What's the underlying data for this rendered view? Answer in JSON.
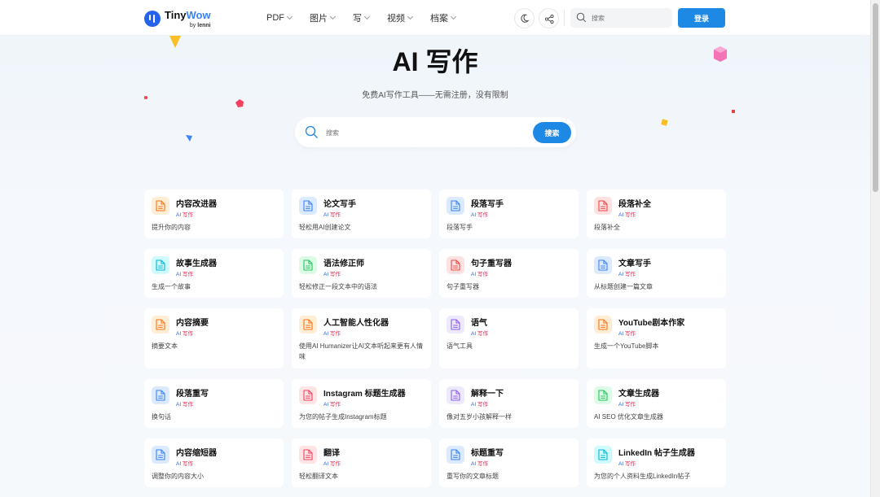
{
  "header": {
    "logo_tiny": "Tiny",
    "logo_wow": "Wow",
    "logo_by": "by",
    "logo_lenni": "lenni",
    "nav": [
      {
        "label": "PDF"
      },
      {
        "label": "图片"
      },
      {
        "label": "写"
      },
      {
        "label": "视频"
      },
      {
        "label": "档案"
      }
    ],
    "search_placeholder": "搜索",
    "login_label": "登录"
  },
  "hero": {
    "title": "AI 写作",
    "subtitle": "免费AI写作工具——无需注册，没有限制",
    "search_placeholder": "搜索",
    "search_button": "搜索"
  },
  "tag": {
    "ai": "AI",
    "w": "写作"
  },
  "colors": {
    "accent": "#1e88e5",
    "tag_ai": "#2563eb",
    "tag_write": "#e11d48"
  },
  "tools": [
    {
      "title": "内容改进器",
      "desc": "提升你的内容",
      "icon": "document-icon",
      "color": "#f97316",
      "bg": "#ffedd5"
    },
    {
      "title": "论文写手",
      "desc": "轻松用AI创建论文",
      "icon": "document-icon",
      "color": "#3b82f6",
      "bg": "#dbeafe"
    },
    {
      "title": "段落写手",
      "desc": "段落写手",
      "icon": "document-icon",
      "color": "#3b82f6",
      "bg": "#dbeafe"
    },
    {
      "title": "段落补全",
      "desc": "段落补全",
      "icon": "document-icon",
      "color": "#ef4444",
      "bg": "#fee2e2"
    },
    {
      "title": "故事生成器",
      "desc": "生成一个故事",
      "icon": "document-icon",
      "color": "#06b6d4",
      "bg": "#cffafe"
    },
    {
      "title": "语法修正师",
      "desc": "轻松修正一段文本中的语法",
      "icon": "document-icon",
      "color": "#22c55e",
      "bg": "#dcfce7"
    },
    {
      "title": "句子重写器",
      "desc": "句子重写器",
      "icon": "document-icon",
      "color": "#ef4444",
      "bg": "#fee2e2"
    },
    {
      "title": "文章写手",
      "desc": "从标题创建一篇文章",
      "icon": "document-icon",
      "color": "#3b82f6",
      "bg": "#dbeafe"
    },
    {
      "title": "内容摘要",
      "desc": "摘要文本",
      "icon": "document-icon",
      "color": "#f97316",
      "bg": "#ffedd5"
    },
    {
      "title": "人工智能人性化器",
      "desc": "使用AI Humanizer让AI文本听起来更有人情味",
      "icon": "document-icon",
      "color": "#f97316",
      "bg": "#ffedd5"
    },
    {
      "title": "语气",
      "desc": "语气工具",
      "icon": "document-icon",
      "color": "#8b5cf6",
      "bg": "#ede9fe"
    },
    {
      "title": "YouTube剧本作家",
      "desc": "生成一个YouTube脚本",
      "icon": "document-icon",
      "color": "#f97316",
      "bg": "#ffedd5"
    },
    {
      "title": "段落重写",
      "desc": "换句话",
      "icon": "document-icon",
      "color": "#3b82f6",
      "bg": "#dbeafe"
    },
    {
      "title": "Instagram 标题生成器",
      "desc": "为您的帖子生成Instagram标题",
      "icon": "document-icon",
      "color": "#f43f5e",
      "bg": "#ffe4e6"
    },
    {
      "title": "解释一下",
      "desc": "像对五岁小孩解释一样",
      "icon": "document-icon",
      "color": "#8b5cf6",
      "bg": "#ede9fe"
    },
    {
      "title": "文章生成器",
      "desc": "AI SEO 优化文章生成器",
      "icon": "document-icon",
      "color": "#22c55e",
      "bg": "#dcfce7"
    },
    {
      "title": "内容缩短器",
      "desc": "调整你的内容大小",
      "icon": "document-icon",
      "color": "#3b82f6",
      "bg": "#dbeafe"
    },
    {
      "title": "翻译",
      "desc": "轻松翻译文本",
      "icon": "document-icon",
      "color": "#f43f5e",
      "bg": "#ffe4e6"
    },
    {
      "title": "标题重写",
      "desc": "重写你的文章标题",
      "icon": "document-icon",
      "color": "#3b82f6",
      "bg": "#dbeafe"
    },
    {
      "title": "LinkedIn 帖子生成器",
      "desc": "为您的个人资料生成LinkedIn帖子",
      "icon": "document-icon",
      "color": "#06b6d4",
      "bg": "#cffafe"
    }
  ]
}
